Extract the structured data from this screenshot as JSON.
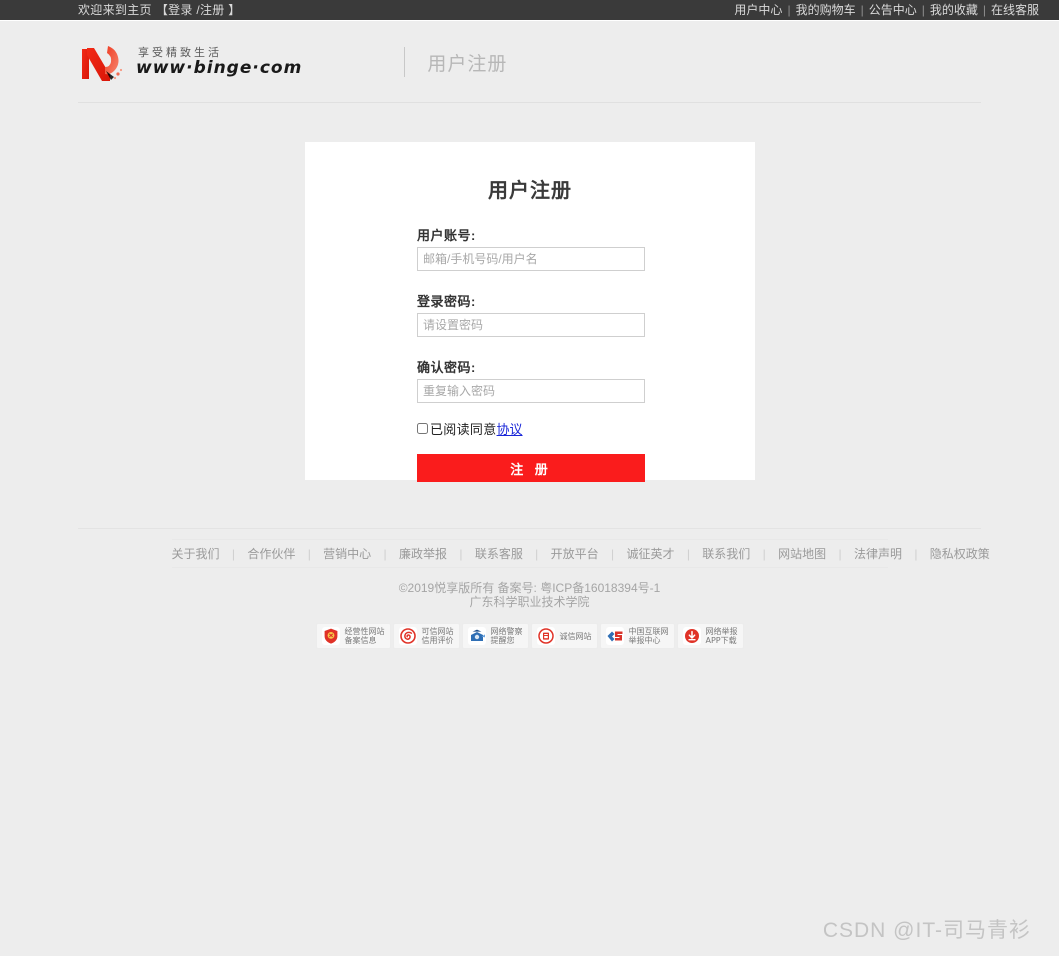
{
  "topbar": {
    "welcome": "欢迎来到主页",
    "auth": "【登录 /注册 】",
    "nav": [
      {
        "label": "用户中心"
      },
      {
        "label": "我的购物车"
      },
      {
        "label": "公告中心"
      },
      {
        "label": "我的收藏"
      },
      {
        "label": "在线客服"
      }
    ],
    "separator": "|",
    "bg_color": "#3a3a3a",
    "text_color": "#d9d9d9"
  },
  "header": {
    "logo_icon": "binge-logo-mark",
    "logo_tagline": "享受精致生活",
    "logo_url": "www·binge·com",
    "page_title": "用户注册"
  },
  "register": {
    "title": "用户注册",
    "fields": [
      {
        "label": "用户账号:",
        "placeholder": "邮箱/手机号码/用户名",
        "value": "",
        "type": "text",
        "name": "account"
      },
      {
        "label": "登录密码:",
        "placeholder": "请设置密码",
        "value": "",
        "type": "password",
        "name": "password"
      },
      {
        "label": "确认密码:",
        "placeholder": "重复输入密码",
        "value": "",
        "type": "password",
        "name": "confirm-password"
      }
    ],
    "agree_text": "已阅读同意",
    "agree_link": "协议",
    "agree_checked": false,
    "submit_label": "注 册",
    "submit_color": "#fa1c1c",
    "link_color": "#1a27d8"
  },
  "footer": {
    "links": [
      {
        "label": "关于我们"
      },
      {
        "label": "合作伙伴"
      },
      {
        "label": "营销中心"
      },
      {
        "label": "廉政举报"
      },
      {
        "label": "联系客服"
      },
      {
        "label": "开放平台"
      },
      {
        "label": "诚征英才"
      },
      {
        "label": "联系我们"
      },
      {
        "label": "网站地图"
      },
      {
        "label": "法律声明"
      },
      {
        "label": "隐私权政策"
      }
    ],
    "separator": "|",
    "copyright_line1": "©2019悦享版所有 备案号: 粤ICP备16018394号-1",
    "copyright_line2": "广东科学职业技术学院",
    "badges": [
      {
        "icon": "business-website-filing-icon",
        "label": "经营性网站\n备案信息",
        "color": "#e03227"
      },
      {
        "icon": "trusted-website-credit-icon",
        "label": "可信网站\n信用评价",
        "color": "#e03227"
      },
      {
        "icon": "cyber-police-icon",
        "label": "网络警察\n提醒您",
        "color": "#2f6fb5"
      },
      {
        "icon": "integrity-website-icon",
        "label": "诚信网站",
        "color": "#e03227"
      },
      {
        "icon": "china-internet-report-center-icon",
        "label": "中国互联网\n举报中心",
        "color": "#2f6fb5"
      },
      {
        "icon": "report-app-download-icon",
        "label": "网络举报\nAPP下载",
        "color": "#e03227"
      }
    ]
  },
  "watermark": {
    "text": "CSDN @IT-司马青衫"
  }
}
